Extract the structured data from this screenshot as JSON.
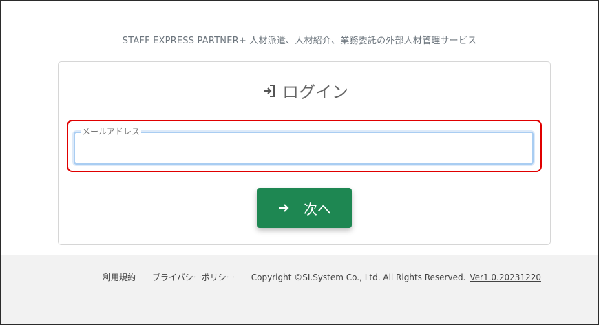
{
  "tagline": "STAFF EXPRESS PARTNER+ 人材派遣、人材紹介、業務委託の外部人材管理サービス",
  "login": {
    "title": "ログイン",
    "title_icon": "login-arrow-icon",
    "email_label": "メールアドレス",
    "email_value": "",
    "next_label": "次へ",
    "next_icon": "arrow-right-icon"
  },
  "footer": {
    "terms": "利用規約",
    "privacy": "プライバシーポリシー",
    "copyright": "Copyright ©SI.System Co., Ltd. All Rights Reserved.",
    "version": "Ver1.0.20231220"
  },
  "colors": {
    "primary_button": "#1e8752",
    "highlight_border": "#e00000",
    "footer_bg": "#f2f2f2"
  }
}
